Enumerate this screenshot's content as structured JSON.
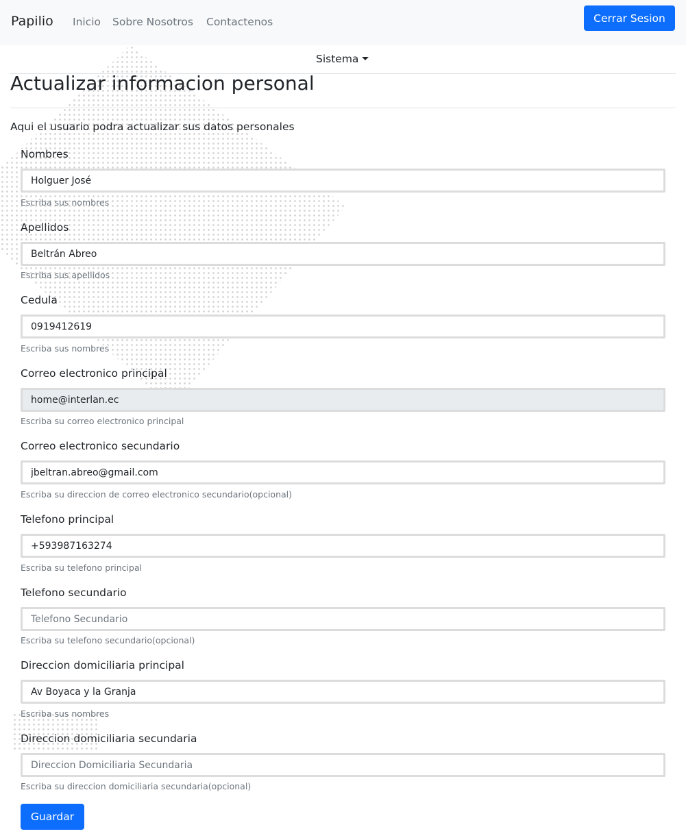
{
  "navbar": {
    "brand": "Papilio",
    "links": [
      "Inicio",
      "Sobre Nosotros",
      "Contactenos"
    ],
    "logout_label": "Cerrar Sesion"
  },
  "system_menu": {
    "label": "Sistema"
  },
  "page": {
    "title": "Actualizar informacion personal",
    "subtitle": "Aqui el usuario podra actualizar sus datos personales"
  },
  "form": {
    "fields": [
      {
        "label": "Nombres",
        "value": "Holguer José",
        "placeholder": "",
        "help": "Escriba sus nombres"
      },
      {
        "label": "Apellidos",
        "value": "Beltrán Abreo",
        "placeholder": "",
        "help": "Escriba sus apellidos"
      },
      {
        "label": "Cedula",
        "value": "0919412619",
        "placeholder": "",
        "help": "Escriba sus nombres"
      },
      {
        "label": "Correo electronico principal",
        "value": "home@interlan.ec",
        "placeholder": "",
        "help": "Escriba su correo electronico principal",
        "readonly": true
      },
      {
        "label": "Correo electronico secundario",
        "value": "jbeltran.abreo@gmail.com",
        "placeholder": "",
        "help": "Escriba su direccion de correo electronico secundario(opcional)"
      },
      {
        "label": "Telefono principal",
        "value": "+593987163274",
        "placeholder": "",
        "help": "Escriba su telefono principal"
      },
      {
        "label": "Telefono secundario",
        "value": "",
        "placeholder": "Telefono Secundario",
        "help": "Escriba su telefono secundario(opcional)"
      },
      {
        "label": "Direccion domiciliaria principal",
        "value": "Av Boyaca y la Granja",
        "placeholder": "",
        "help": "Escriba sus nombres"
      },
      {
        "label": "Direccion domiciliaria secundaria",
        "value": "",
        "placeholder": "Direccion Domiciliaria Secundaria",
        "help": "Escriba su direccion domiciliaria secundaria(opcional)"
      }
    ],
    "submit_label": "Guardar"
  },
  "colors": {
    "primary": "#0d6efd",
    "navbar_bg": "#f8f9fa",
    "muted": "#6c757d",
    "readonly_bg": "#e9ecef"
  }
}
